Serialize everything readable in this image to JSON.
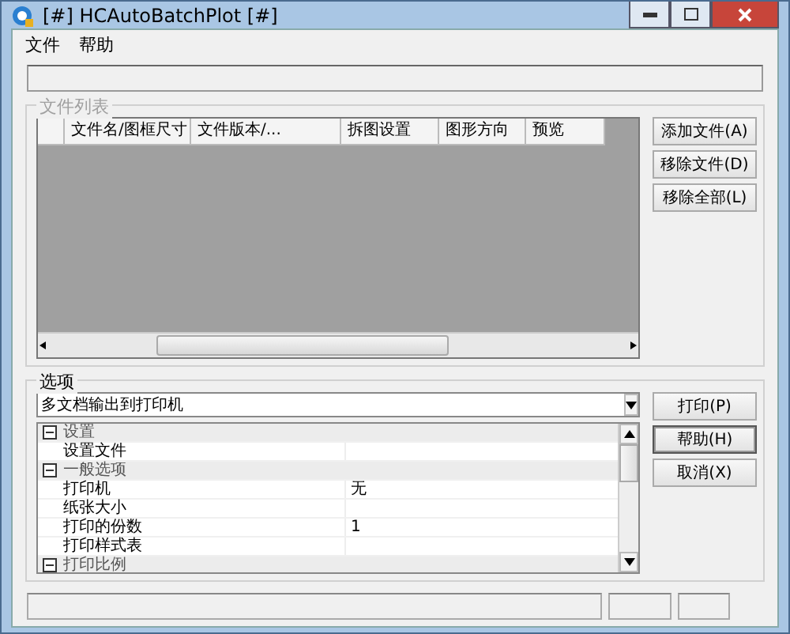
{
  "window": {
    "title": "[#] HCAutoBatchPlot [#]"
  },
  "menu": [
    {
      "label": "文件"
    },
    {
      "label": "帮助"
    }
  ],
  "file_list": {
    "title": "文件列表",
    "columns": [
      "文件名/图框尺寸",
      "文件版本/...",
      "拆图设置",
      "图形方向",
      "预览"
    ],
    "buttons": [
      "添加文件(A)",
      "移除文件(D)",
      "移除全部(L)"
    ]
  },
  "options": {
    "title": "选项",
    "mode": "多文档输出到打印机",
    "properties": [
      {
        "kind": "category",
        "label": "设置",
        "expanded": true
      },
      {
        "kind": "item",
        "label": "设置文件"
      },
      {
        "kind": "category",
        "label": "一般选项",
        "expanded": true
      },
      {
        "kind": "item",
        "label": "打印机",
        "value": "无"
      },
      {
        "kind": "item",
        "label": "纸张大小"
      },
      {
        "kind": "item",
        "label": "打印的份数",
        "value": "1"
      },
      {
        "kind": "item",
        "label": "打印样式表"
      },
      {
        "kind": "category",
        "label": "打印比例",
        "expanded": true
      }
    ],
    "buttons": [
      {
        "label": "打印(P)",
        "default": false
      },
      {
        "label": "帮助(H)",
        "default": true
      },
      {
        "label": "取消(X)",
        "default": false
      }
    ]
  }
}
